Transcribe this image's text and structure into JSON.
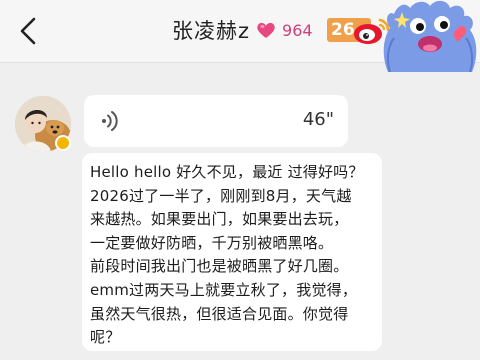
{
  "header": {
    "title": "张凌赫z",
    "heart_count": "964",
    "level_badge": "26"
  },
  "voice_message": {
    "duration": "46\""
  },
  "text_message": {
    "lines": [
      "Hello hello 好久不见，最近 过得好吗？",
      "2026过了一半了，刚刚到8月，天气越",
      "来越热。如果要出门，如果要出去玩，",
      "一定要做好防晒，千万别被晒黑咯。",
      "前段时间我出门也是被晒黑了好几圈。",
      "emm过两天马上就要立秋了，我觉得，",
      "虽然天气很热，但很适合见面。你觉得",
      "呢？"
    ]
  },
  "colors": {
    "accent_pink": "#d0407a",
    "badge_orange": "#f0a04a",
    "weibo_red": "#e6162d",
    "sticker_blue": "#7b9be6"
  },
  "icons": [
    "back-arrow-icon",
    "heart-icon",
    "weibo-icon",
    "monster-sticker",
    "voice-icon",
    "avatar"
  ]
}
